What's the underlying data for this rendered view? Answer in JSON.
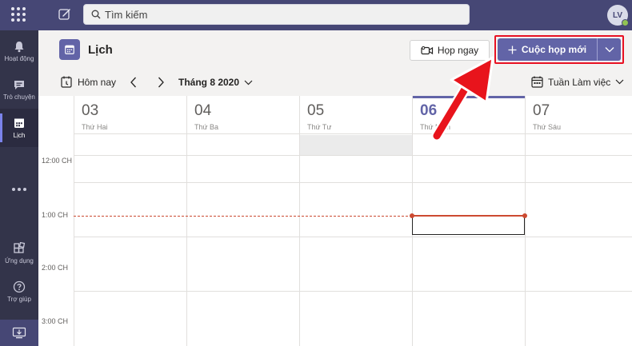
{
  "topbar": {
    "search_placeholder": "Tìm kiếm",
    "avatar_initials": "LV"
  },
  "rail": {
    "items": [
      {
        "label": "Hoạt động",
        "icon": "bell-icon"
      },
      {
        "label": "Trò chuyện",
        "icon": "chat-icon"
      },
      {
        "label": "Lịch",
        "icon": "calendar-icon",
        "active": true
      },
      {
        "label": "Ứng dụng",
        "icon": "apps-icon"
      },
      {
        "label": "Trợ giúp",
        "icon": "help-icon"
      }
    ]
  },
  "header": {
    "title": "Lịch",
    "meet_now_label": "Họp ngay",
    "new_meeting_label": "Cuộc họp mới"
  },
  "toolbar": {
    "today_label": "Hôm nay",
    "month_label": "Tháng 8 2020",
    "view_label": "Tuần Làm việc"
  },
  "calendar": {
    "days": [
      {
        "num": "03",
        "name": "Thứ Hai"
      },
      {
        "num": "04",
        "name": "Thứ Ba"
      },
      {
        "num": "05",
        "name": "Thứ Tư"
      },
      {
        "num": "06",
        "name": "Thứ Năm",
        "today": true
      },
      {
        "num": "07",
        "name": "Thứ Sáu"
      }
    ],
    "times": [
      "12:00 CH",
      "1:00 CH",
      "2:00 CH",
      "3:00 CH"
    ]
  },
  "colors": {
    "brand": "#6264a7",
    "topbar": "#464775",
    "rail": "#33344a",
    "now_line": "#cc4a31",
    "highlight_frame": "#e81123"
  }
}
